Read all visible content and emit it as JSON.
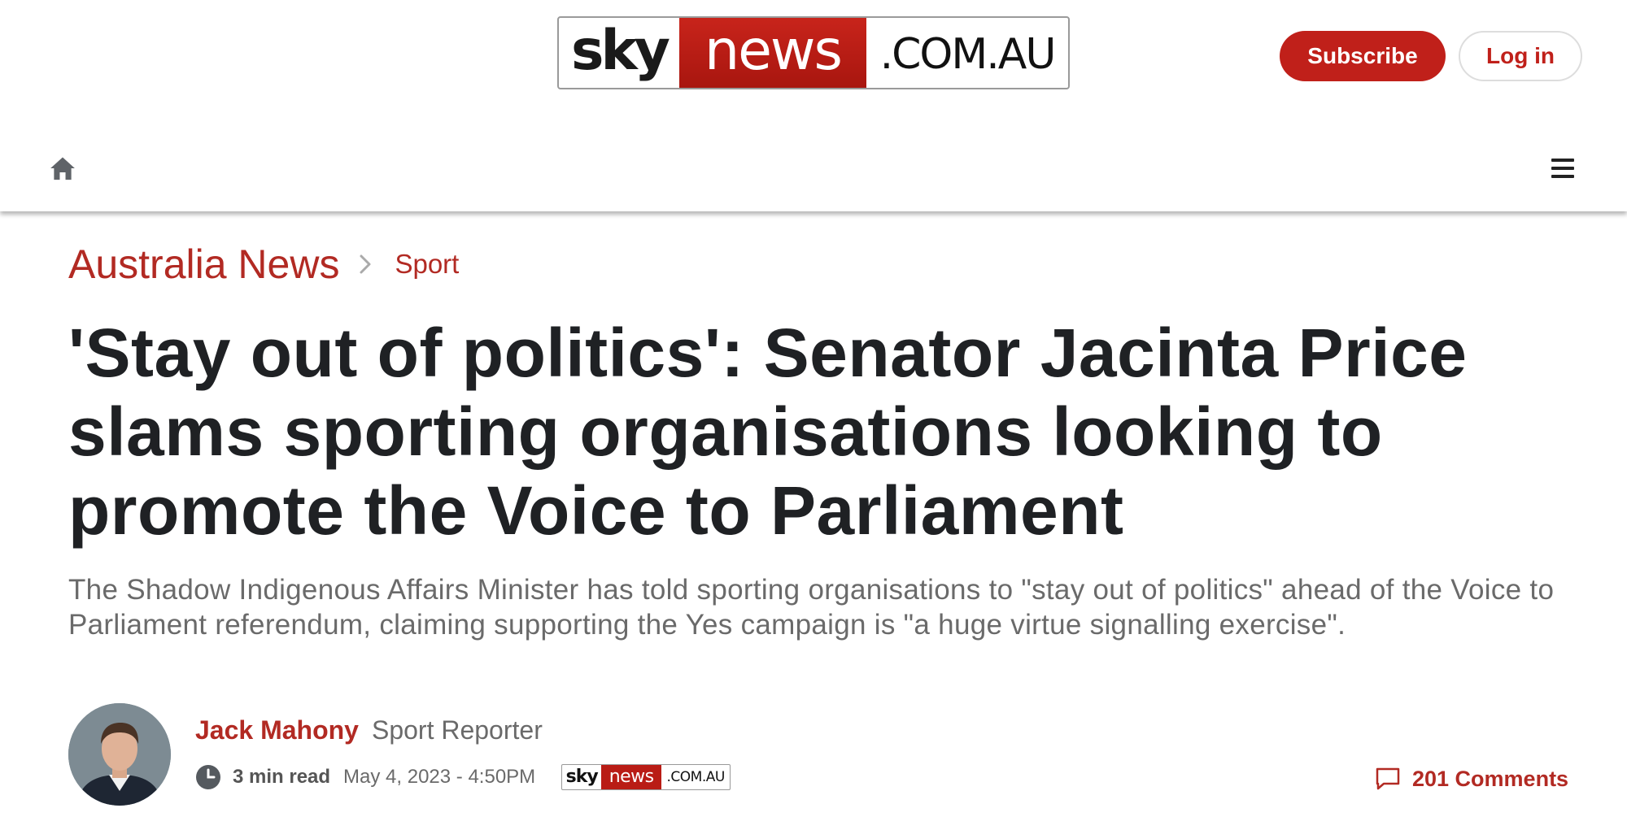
{
  "header": {
    "logo": {
      "sky": "sky",
      "news": "news",
      "domain": ".COM.AU"
    },
    "subscribe_label": "Subscribe",
    "login_label": "Log in",
    "home_icon": "home-icon",
    "menu_icon": "hamburger-menu-icon"
  },
  "breadcrumb": {
    "section": "Australia News",
    "subsection": "Sport"
  },
  "article": {
    "headline": "'Stay out of politics': Senator Jacinta Price slams sporting organisations looking to promote the Voice to Parliament",
    "standfirst": "The Shadow Indigenous Affairs Minister has told sporting organisations to \"stay out of politics\" ahead of the Voice to Parliament referendum, claiming supporting the Yes campaign is \"a huge virtue signalling exercise\"."
  },
  "byline": {
    "author_name": "Jack Mahony",
    "author_role": "Sport Reporter",
    "read_time": "3 min read",
    "date": "May 4, 2023 - 4:50PM",
    "source_logo": {
      "sky": "sky",
      "news": "news",
      "domain": ".COM.AU"
    },
    "comments": "201 Comments"
  },
  "colors": {
    "brand_red": "#c0201a",
    "link_red": "#b22a23",
    "headline": "#1f2124",
    "muted": "#6a6a6a"
  }
}
